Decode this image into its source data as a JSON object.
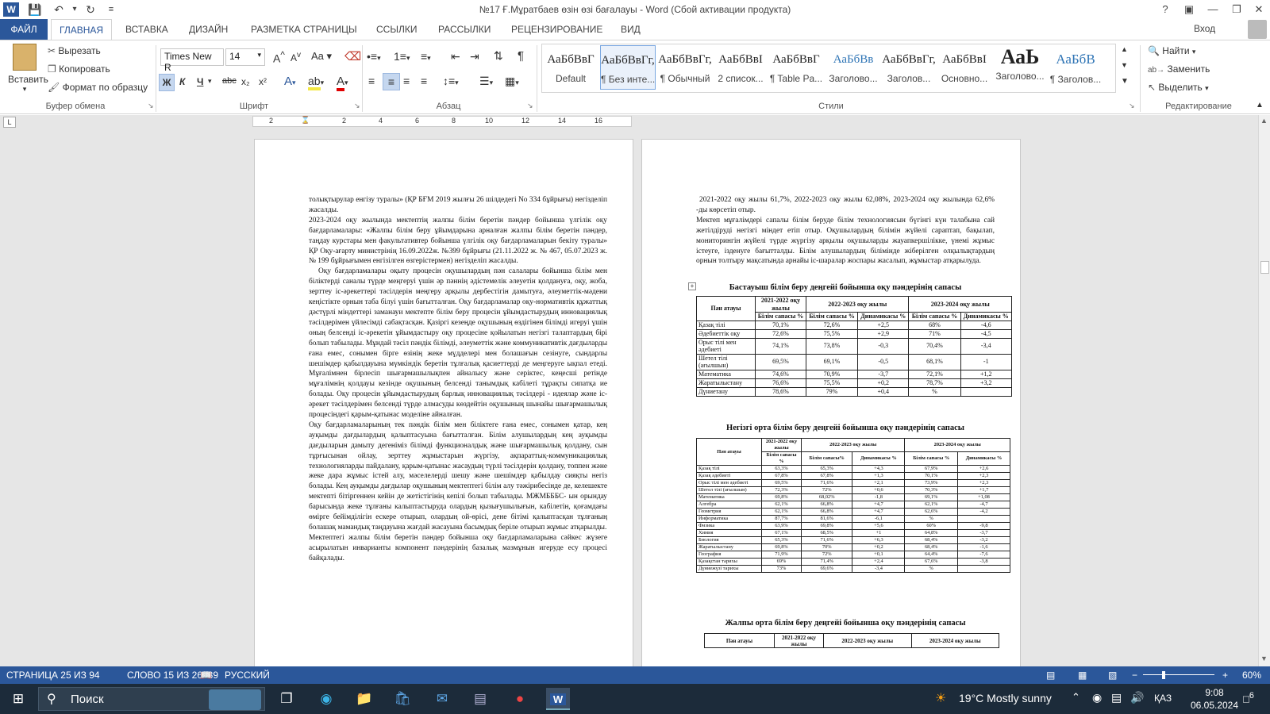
{
  "window": {
    "title": "№17 Ғ.Мұратбаев өзін өзі бағалауы - Word (Сбой активации продукта)",
    "help": "?",
    "login": "Вход"
  },
  "tabs": [
    {
      "label": "ФАЙЛ"
    },
    {
      "label": "ГЛАВНАЯ"
    },
    {
      "label": "ВСТАВКА"
    },
    {
      "label": "ДИЗАЙН"
    },
    {
      "label": "РАЗМЕТКА СТРАНИЦЫ"
    },
    {
      "label": "ССЫЛКИ"
    },
    {
      "label": "РАССЫЛКИ"
    },
    {
      "label": "РЕЦЕНЗИРОВАНИЕ"
    },
    {
      "label": "ВИД"
    }
  ],
  "clipboard": {
    "paste": "Вставить",
    "cut": "Вырезать",
    "copy": "Копировать",
    "format_painter": "Формат по образцу",
    "group": "Буфер обмена"
  },
  "font": {
    "family": "Times New R",
    "size": "14",
    "group": "Шрифт",
    "bold": "Ж",
    "italic": "К",
    "underline": "Ч",
    "strike": "abc",
    "sub": "x₂",
    "sup": "x²",
    "case": "Aa"
  },
  "paragraph": {
    "group": "Абзац"
  },
  "styles": {
    "group": "Стили",
    "items": [
      {
        "preview": "АаБбВвГ",
        "name": "Default"
      },
      {
        "preview": "АаБбВвГг,",
        "name": "¶ Без инте..."
      },
      {
        "preview": "АаБбВвГг,",
        "name": "¶ Обычный"
      },
      {
        "preview": "АаБбВвI",
        "name": "2 список..."
      },
      {
        "preview": "АаБбВвГ",
        "name": "¶ Table Pa..."
      },
      {
        "preview": "АаБбВв",
        "name": "Заголово..."
      },
      {
        "preview": "АаБбВвГг,",
        "name": "Заголов..."
      },
      {
        "preview": "АаБбВвI",
        "name": "Основно..."
      },
      {
        "preview": "АаЬ",
        "name": "Заголово..."
      },
      {
        "preview": "АаБбВ",
        "name": "¶ Заголов..."
      }
    ]
  },
  "editing": {
    "group": "Редактирование",
    "find": "Найти",
    "replace": "Заменить",
    "select": "Выделить"
  },
  "ruler": {
    "marks": [
      "2",
      "2",
      "4",
      "6",
      "8",
      "10",
      "12",
      "14",
      "16"
    ]
  },
  "left_page": {
    "paragraphs": [
      "толықтырулар енгізу туралы» (ҚР БҒМ 2019 жылғы 26 шілдедегі No 334 бұйрығы) негізделіп жасалды.",
      "2023-2024 оқу жылында мектептің жалпы білім беретін пәндер бойынша үлгілік оқу бағдарламалары: «Жалпы білім беру ұйымдарына арналған жалпы білім беретін пәндер, таңдау курстары мен факультативтер бойынша үлгілік оқу бағдарламаларын бекіту туралы» ҚР Оқу-ағарту министрінің 16.09.2022ж. №399 бұйрығы (21.11.2022 ж. № 467, 05.07.2023 ж. № 199 бұйрығымен енгізілген өзгерістермен) негізделіп жасалды.",
      "Оқу бағдарламалары оқыту процесін оқушылардың пән салалары бойынша білім мен біліктерді саналы түрде меңгеруі үшін әр пәннің әдістемелік әлеуетін қолдануға, оқу, жоба, зерттеу іс-әрекеттері тәсілдерін меңгеру арқылы дербестігін дамытуға, әлеуметтік-мәдени кеңістікте орнын таба білуі үшін бағытталған. Оқу бағдарламалар оқу-нормативтік құжаттық дәстүрлі міндеттері заманауи мектепте білім беру процесін ұйымдастырудың инновациялық тәсілдерімен үйлесімді сабақтасқан. Қазіргі кезеңде оқушының өздігінен білімді игеруі үшін оның белсенді іс-әрекетін ұйымдастыру оқу процесіне қойылатын негізгі талаптардың бірі болып табылады. Мұндай тәсіл пәндік білімді, әлеуметтік және коммуникативтік дағдыларды ғана емес, сонымен бірге өзінің жеке мүдделері мен болашағын сезінуге, сындарлы шешімдер қабылдауына мүмкіндік беретін тұлғалық қасиеттерді де меңгеруге ықпал етеді. Мұғалімнен бірлесіп шығармашылықпен айналысу және серіктес, кеңесші ретінде мұғалімнің қолдауы кезінде оқушының белсенді танымдық кабілеті тұрақты сипатқа ие болады. Оқу процесін ұйымдастырудың барлық инновациялық тәсілдері - идеялар және іс-әрекет тәсілдерімен белсенді түрде алмасуды көздейтін оқушының шынайы шығармашылық процесіндегі қарым-қатынас моделіне айналған.",
      "Оқу бағдарламаларының тек пәндік білім мен біліктеге ғана емес, сонымен қатар, кең ауқымды дағдылардың қалыптасуына бағытталған. Білім алушылардың кең ауқымды дағдыларын дамыту дегеніміз білімді функционалдық және шығармашылық қолдану, сын тұрғысынан ойлау, зерттеу жұмыстарын жүргізу, ақпараттық-коммуникациялық технологияларды пайдалану, қарым-қатынас жасаудың түрлі тәсілдерін қолдану, топпен және жеке дара жұмыс істей алу, мәселелерді шешу және шешімдер қабылдау сияқты негіз болады. Кең ауқымды дағдылар оқушының мектептегі білім алу тәжірибесінде де, келешекте мектепті бітіргеннен кейін де жетістігінің кепілі болып табылады. МЖМБББС- ын орындау барысында жеке тұлғаны калыптастыруда олардың қызығушылығын, кабілетін, қоғамдағы өмірге бейімділігін ескере отырып, олардың ой-өрісі, дене бітімі қалыптасқан тұлғаның болашақ мамандық таңдауына жағдай жасауына басымдық беріле отырып жұмыс атқарылды.",
      "Мектептегі жалпы білім беретін пәндер бойынша оқу бағдарламаларына сәйкес жүзеге асырылатын инварианты компонент пәндерінің базалық мазмұнын игеруде есу процесі байқалады."
    ]
  },
  "right_page": {
    "intro": "2021-2022 оқу жылы 61,7%, 2022-2023 оқу жылы 62,08%, 2023-2024 оқу жылында 62,6% -ды көрсетіп отыр.",
    "para": "Мектеп мұғалімдері сапалы білім беруде білім технологиясын бүгінгі күн талабына сай жетілдіруді негізгі міндет етіп отыр. Оқушылардың білімін жүйелі сараптап, бақылап, мониторингін жүйелі түрде жүргізу арқылы оқушыларды жауапкершілікке, үнемі жұмыс істеуге, ізденуге бағытталды. Білім алушылардың білімінде жіберілген олқылықтардың орнын толтыру мақсатында арнайы іс-шаралар жоспары жасалып, жұмыстар атқарылуда.",
    "table1": {
      "title": "Бастауыш білім беру деңгейі бойынша оқу пәндерінің сапасы",
      "h_subject": "Пән атауы",
      "h_y1": "2021-2022 оқу жылы",
      "h_y2": "2022-2023 оқу жылы",
      "h_y3": "2023-2024 оқу жылы",
      "h_quality": "Білім сапасы %",
      "h_dyn": "Динамикасы %",
      "rows": [
        [
          "Қазақ тілі",
          "70,1%",
          "72,6%",
          "+2,5",
          "68%",
          "-4,6"
        ],
        [
          "Әдебиеттік оқу",
          "72,6%",
          "75,5%",
          "+2,9",
          "71%",
          "-4,5"
        ],
        [
          "Орыс тілі мен әдебиеті",
          "74,1%",
          "73,8%",
          "-0,3",
          "70,4%",
          "-3,4"
        ],
        [
          "Шетел тілі (ағылшын)",
          "69,5%",
          "69,1%",
          "-0,5",
          "68,1%",
          "-1"
        ],
        [
          "Математика",
          "74,6%",
          "70,9%",
          "-3,7",
          "72,1%",
          "+1,2"
        ],
        [
          "Жаратылыстану",
          "76,6%",
          "75,5%",
          "+0,2",
          "78,7%",
          "+3,2"
        ],
        [
          "Дүниетану",
          "78,6%",
          "79%",
          "+0,4",
          "%",
          ""
        ]
      ]
    },
    "table2": {
      "title": "Негізгі орта білім беру деңгейі бойынша оқу пәндерінің сапасы",
      "h_subject": "Пән атауы",
      "h_y1": "2021-2022 оқу жылы",
      "h_y2": "2022-2023 оқу жылы",
      "h_y3": "2023-2024 оқу жылы",
      "h_q1": "Білім сапасы %",
      "h_q2": "Білім сапасы%",
      "h_dyn": "Динамикасы %",
      "h_q3": "Білім сапасы %",
      "rows": [
        [
          "Қазақ тілі",
          "63,3%",
          "65,3%",
          "+4,3",
          "67,9%",
          "+2,6"
        ],
        [
          "Қазақ әдебиеті",
          "67,8%",
          "67,8%",
          "+1,3",
          "70,1%",
          "+2,3"
        ],
        [
          "Орыс тілі мен әдебиеті",
          "69,5%",
          "71,6%",
          "+2,1",
          "73,9%",
          "+2,3"
        ],
        [
          "Шетел тілі (ағылшын)",
          "72,3%",
          "72%",
          "+0,6",
          "70,3%",
          "+1,7"
        ],
        [
          "Математика",
          "69,8%",
          "68,02%",
          "-1,8",
          "69,1%",
          "+1,08"
        ],
        [
          "Алгебра",
          "62,1%",
          "66,8%",
          "+4,7",
          "62,1%",
          "-4,7"
        ],
        [
          "Геометрия",
          "62,1%",
          "66,8%",
          "+4,7",
          "62,6%",
          "-4,2"
        ],
        [
          "Информатика",
          "87,7%",
          "81,6%",
          "-6,1",
          "%",
          ""
        ],
        [
          "Физика",
          "63,9%",
          "69,8%",
          "+5,6",
          "60%",
          "-9,8"
        ],
        [
          "Химия",
          "67,1%",
          "68,5%",
          "+1",
          "64,8%",
          "-3,7"
        ],
        [
          "Биология",
          "65,3%",
          "71,6%",
          "+6,3",
          "68,4%",
          "-3,2"
        ],
        [
          "Жаратылыстану",
          "69,8%",
          "70%",
          "+0,2",
          "68,4%",
          "-1,6"
        ],
        [
          "География",
          "71,9%",
          "72%",
          "+0,1",
          "64,4%",
          "-7,6"
        ],
        [
          "Қазақстан тарихы",
          "69%",
          "71,4%",
          "+2,4",
          "67,6%",
          "-3,8"
        ],
        [
          "Дүниежүзі тарихы",
          "73%",
          "69,6%",
          "-3,4",
          "%",
          ""
        ]
      ]
    },
    "table3": {
      "title": "Жалпы орта білім беру деңгейі бойынша оқу пәндерінің сапасы",
      "h_subject": "Пән атауы",
      "h_y1": "2021-2022 оқу жылы",
      "h_y2": "2022-2023 оқу жылы",
      "h_y3": "2023-2024 оқу жылы"
    }
  },
  "status": {
    "page": "СТРАНИЦА 25 ИЗ 94",
    "words": "СЛОВО 15 ИЗ 26539",
    "lang": "РУССКИЙ",
    "zoom": "60%"
  },
  "taskbar": {
    "search": "Поиск",
    "weather": "19°C  Mostly sunny",
    "lang": "ҚАЗ",
    "time": "9:08",
    "date": "06.05.2024",
    "notif": "6"
  }
}
